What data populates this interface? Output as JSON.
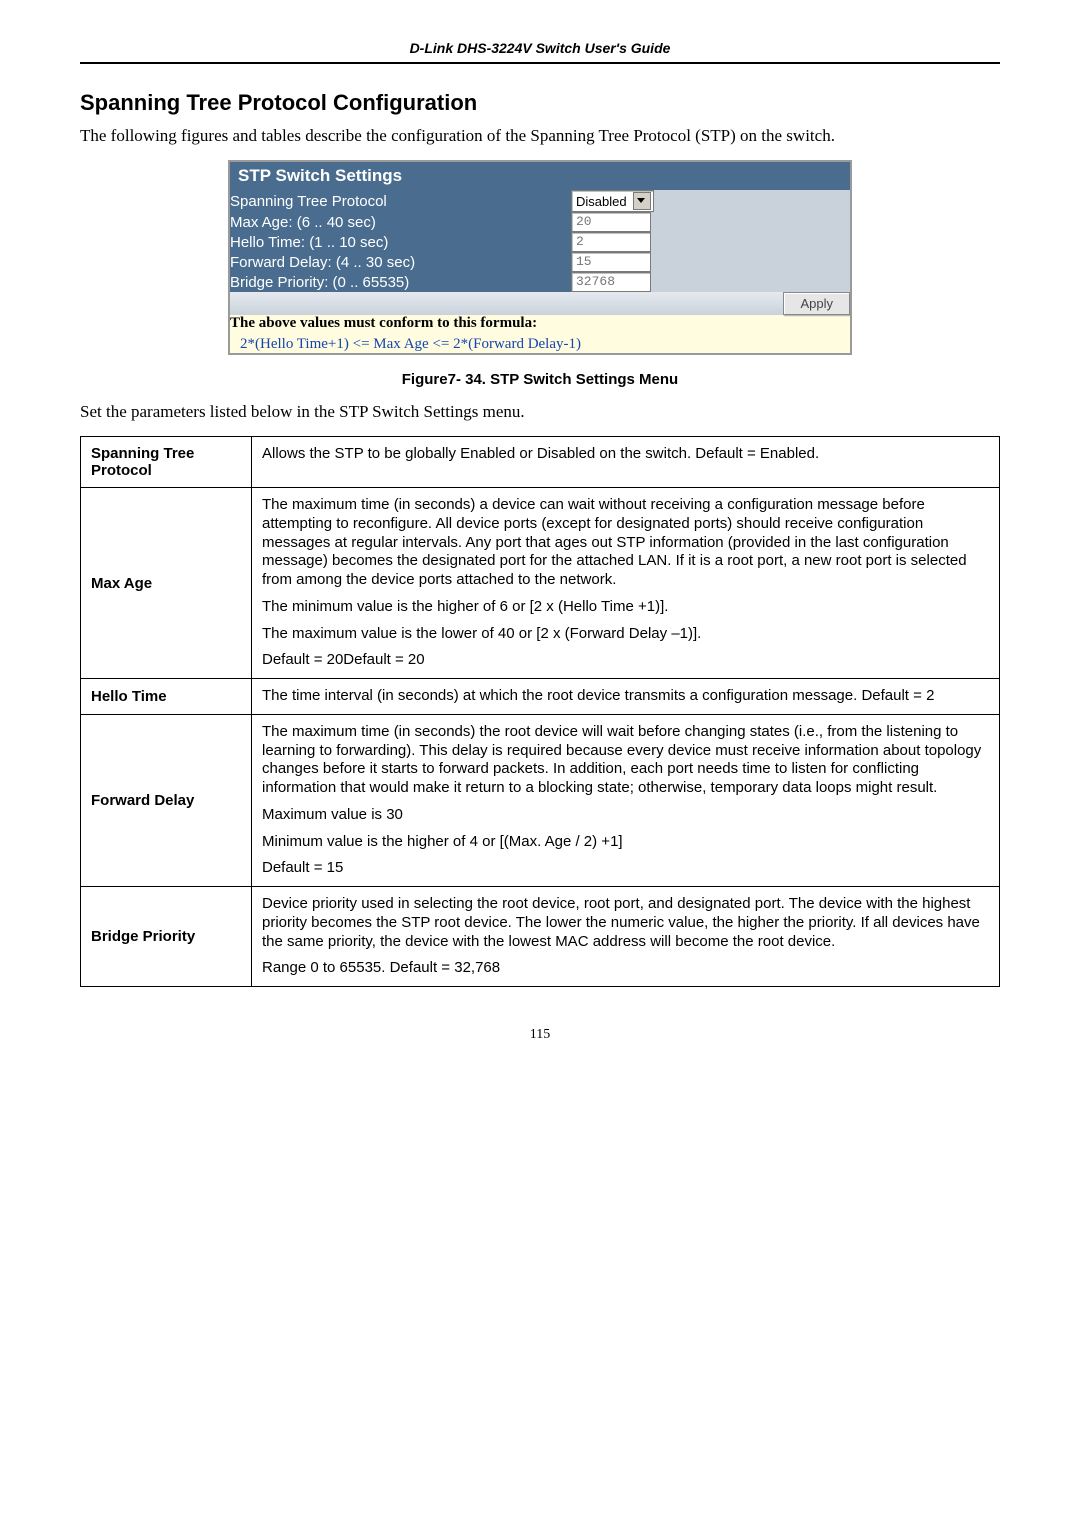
{
  "header": {
    "title": "D-Link DHS-3224V Switch User's Guide"
  },
  "section": {
    "title": "Spanning Tree Protocol Configuration",
    "intro": "The following figures and tables describe the configuration of the Spanning Tree Protocol (STP) on the switch."
  },
  "stp_panel": {
    "title": "STP Switch Settings",
    "rows": {
      "protocol_label": "Spanning Tree Protocol",
      "protocol_value": "Disabled",
      "maxage_label": "Max Age: (6 .. 40 sec)",
      "maxage_value": "20",
      "hello_label": "Hello Time: (1 .. 10 sec)",
      "hello_value": "2",
      "fwd_label": "Forward Delay: (4 .. 30 sec)",
      "fwd_value": "15",
      "bp_label": "Bridge Priority: (0 .. 65535)",
      "bp_value": "32768"
    },
    "apply_label": "Apply",
    "formula_title": "The above values must conform to this formula:",
    "formula_line": "2*(Hello Time+1) <= Max Age <= 2*(Forward Delay-1)"
  },
  "figure_caption": "Figure7- 34.  STP Switch Settings Menu",
  "subnote": "Set the parameters listed below in the STP Switch Settings menu.",
  "table": {
    "r1_label": "Spanning Tree Protocol",
    "r1_p1": "Allows the STP to be globally Enabled or Disabled on the switch. Default = Enabled.",
    "r2_label": "Max Age",
    "r2_p1": "The maximum time (in seconds) a device can wait without receiving a configuration message before attempting to reconfigure.  All device ports (except for designated ports) should receive configuration messages at regular intervals.  Any port that ages out STP information (provided in the last configuration message) becomes the designated port for the attached LAN.  If it is a root port, a new root port is selected from among the device ports attached to the network.",
    "r2_p2": "The minimum value is the higher of 6 or [2 x (Hello Time +1)].",
    "r2_p3": "The maximum value is the lower of 40 or [2 x (Forward Delay –1)].",
    "r2_p4": "Default = 20Default = 20",
    "r3_label": "Hello Time",
    "r3_p1": "The time interval (in seconds) at which the root device transmits a configuration message. Default = 2",
    "r4_label": "Forward Delay",
    "r4_p1": "The maximum time (in seconds) the root device will wait before changing states (i.e., from the listening to learning to forwarding).  This delay is required because every device must receive information about topology changes before it starts to forward packets.  In addition, each port needs time to listen for conflicting information that would make it return to a blocking state; otherwise, temporary data loops might result.",
    "r4_p2": "Maximum value is 30",
    "r4_p3": "Minimum value is the higher of 4 or [(Max. Age / 2) +1]",
    "r4_p4": "Default = 15",
    "r5_label": "Bridge Priority",
    "r5_p1": "Device priority used in selecting the root device, root port, and designated port.  The device with the highest priority becomes the STP root device.  The lower the numeric value, the higher the priority.  If all devices have the same priority, the device with the lowest MAC address will become the root device.",
    "r5_p2": "Range 0 to 65535. Default = 32,768"
  },
  "page_number": "115"
}
